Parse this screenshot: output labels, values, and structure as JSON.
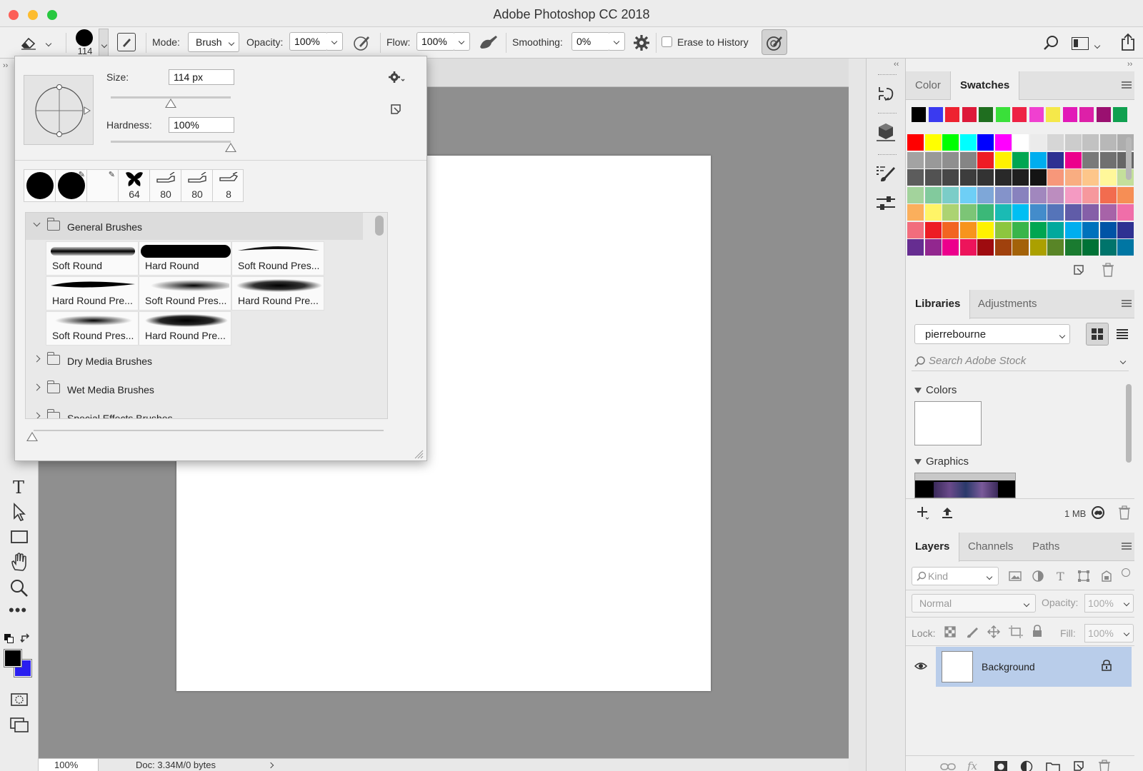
{
  "window": {
    "title": "Adobe Photoshop CC 2018"
  },
  "options_bar": {
    "brush_size": "114",
    "mode_label": "Mode:",
    "mode_value": "Brush",
    "opacity_label": "Opacity:",
    "opacity_value": "100%",
    "flow_label": "Flow:",
    "flow_value": "100%",
    "smoothing_label": "Smoothing:",
    "smoothing_value": "0%",
    "erase_to_history_label": "Erase to History"
  },
  "brush_popup": {
    "size_label": "Size:",
    "size_value": "114 px",
    "hardness_label": "Hardness:",
    "hardness_value": "100%",
    "size_slider_fraction": 0.5,
    "hardness_slider_fraction": 1.0,
    "recent_brushes": [
      {
        "label": ""
      },
      {
        "label": ""
      },
      {
        "label": ""
      },
      {
        "label": "64"
      },
      {
        "label": "80"
      },
      {
        "label": "80"
      },
      {
        "label": "8"
      }
    ],
    "groups": [
      {
        "name": "General Brushes",
        "expanded": true,
        "brushes": [
          "Soft Round",
          "Hard Round",
          "Soft Round Pres...",
          "Hard Round Pre...",
          "Soft Round Pres...",
          "Hard Round Pre...",
          "Soft Round Pres...",
          "Hard Round Pre..."
        ]
      },
      {
        "name": "Dry Media Brushes",
        "expanded": false
      },
      {
        "name": "Wet Media Brushes",
        "expanded": false
      },
      {
        "name": "Special Effects Brushes",
        "expanded": false
      }
    ]
  },
  "status_bar": {
    "zoom": "100%",
    "doc_info": "Doc: 3.34M/0 bytes"
  },
  "color_panel": {
    "tabs": [
      "Color",
      "Swatches"
    ],
    "active_tab": "Swatches",
    "recent_swatches": [
      "#000000",
      "#3a3af0",
      "#ee2230",
      "#dd1a3a",
      "#1f6e1f",
      "#3ae03a",
      "#ee2244",
      "#f040d0",
      "#f5e84a",
      "#e21ab8",
      "#dd20a8",
      "#9a1070",
      "#10a050"
    ],
    "swatch_rows": [
      [
        "#ff0000",
        "#ffff00",
        "#00ff00",
        "#00ffff",
        "#0000ff",
        "#ff00ff",
        "#ffffff",
        "#ebebeb",
        "#d6d6d6",
        "#cccccc",
        "#c2c2c2",
        "#b8b8b8",
        "#adadad"
      ],
      [
        "#a3a3a3",
        "#999999",
        "#8f8f8f",
        "#858585",
        "#ee1c24",
        "#fff200",
        "#00a651",
        "#00aeef",
        "#2e3192",
        "#ec008c",
        "#7a7a7a",
        "#707070",
        "#666666"
      ],
      [
        "#5c5c5c",
        "#525252",
        "#474747",
        "#3d3d3d",
        "#333333",
        "#292929",
        "#1f1f1f",
        "#141414",
        "#f7977a",
        "#f9ad81",
        "#fdc68a",
        "#fff79a",
        "#c4df9b"
      ],
      [
        "#a3d39c",
        "#82ca9d",
        "#7bcdc8",
        "#6ecff6",
        "#7ea7d8",
        "#8493ca",
        "#8882be",
        "#a187be",
        "#bc8dbf",
        "#f49ac2",
        "#f6989d",
        "#f26c4f",
        "#f68e55"
      ],
      [
        "#fbaf5c",
        "#fff467",
        "#acd372",
        "#7cc576",
        "#3bb878",
        "#1abbb4",
        "#00bff3",
        "#438ccb",
        "#5574b9",
        "#605ca8",
        "#855fa8",
        "#a763a8",
        "#f06ea9"
      ],
      [
        "#f26d7d",
        "#ed1c24",
        "#f26522",
        "#f7941d",
        "#fff200",
        "#8dc63f",
        "#39b54a",
        "#00a651",
        "#00a99d",
        "#00aeef",
        "#0072bc",
        "#0054a6",
        "#2e3192"
      ],
      [
        "#662d91",
        "#92278f",
        "#ec008c",
        "#ed145b",
        "#9e0b0f",
        "#a0410d",
        "#a36209",
        "#aba000",
        "#598527",
        "#1a7b30",
        "#007236",
        "#00746b",
        "#0076a3"
      ]
    ]
  },
  "libraries_panel": {
    "tabs": [
      "Libraries",
      "Adjustments"
    ],
    "active_tab": "Libraries",
    "library_name": "pierrebourne",
    "search_placeholder": "Search Adobe Stock",
    "colors_section": "Colors",
    "graphics_section": "Graphics",
    "storage": "1 MB"
  },
  "layers_panel": {
    "tabs": [
      "Layers",
      "Channels",
      "Paths"
    ],
    "active_tab": "Layers",
    "filter_kind": "Kind",
    "blend_mode": "Normal",
    "opacity_label": "Opacity:",
    "opacity_value": "100%",
    "lock_label": "Lock:",
    "fill_label": "Fill:",
    "fill_value": "100%",
    "layers": [
      {
        "name": "Background",
        "visible": true,
        "locked": true
      }
    ]
  },
  "colors": {
    "foreground": "#000000",
    "background": "#2a1ff0",
    "selected_layer": "#b9cdea"
  }
}
